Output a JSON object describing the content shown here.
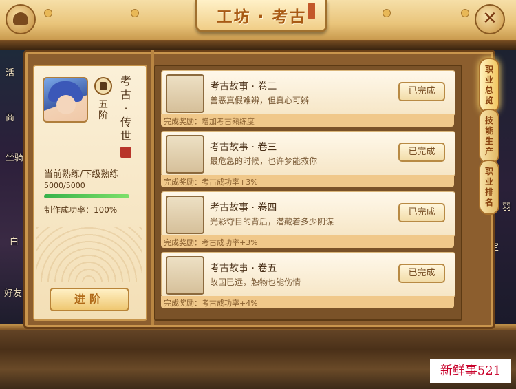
{
  "header": {
    "title": "工坊 · 考古",
    "close_label": "✕"
  },
  "side_left": [
    "活",
    "商",
    "坐骑",
    "白",
    "好友"
  ],
  "side_right": [
    "羽",
    "定"
  ],
  "tabs": [
    {
      "label": [
        "职",
        "业",
        "总",
        "览"
      ],
      "active": true
    },
    {
      "label": [
        "技",
        "能",
        "生",
        "产"
      ],
      "active": false
    },
    {
      "label": [
        "职",
        "业",
        "排",
        "名"
      ],
      "active": false
    }
  ],
  "profile": {
    "rank": [
      "五",
      "阶"
    ],
    "title_chars": [
      "考",
      "古",
      "·",
      "传",
      "世"
    ],
    "proficiency_label": "当前熟练/下级熟练",
    "proficiency_value": "5000/5000",
    "proficiency_fraction": 1.0,
    "success_rate_label": "制作成功率：100%",
    "advance_button": "进阶"
  },
  "quests": [
    {
      "title": "考古故事 · 卷二",
      "desc": "善恶真假难辨，但真心可辨",
      "status": "已完成",
      "reward": "完成奖励：增加考古熟练度",
      "icon": "jade-vessel-icon"
    },
    {
      "title": "考古故事 · 卷三",
      "desc": "最危急的时候，也许梦能救你",
      "status": "已完成",
      "reward": "完成奖励：考古成功率+3%",
      "icon": "flower-scroll-icon"
    },
    {
      "title": "考古故事 · 卷四",
      "desc": "光彩夺目的背后，潜藏着多少阴谋",
      "status": "已完成",
      "reward": "完成奖励：考古成功率+3%",
      "icon": "pipa-lute-icon"
    },
    {
      "title": "考古故事 · 卷五",
      "desc": "故国已远，触物也能伤情",
      "status": "已完成",
      "reward": "完成奖励：考古成功率+4%",
      "icon": "golden-bowl-icon"
    }
  ],
  "watermark": "新鲜事521",
  "colors": {
    "accent": "#b06a18",
    "progress": "#36b24a",
    "reward_bar": "#f0c88a"
  }
}
